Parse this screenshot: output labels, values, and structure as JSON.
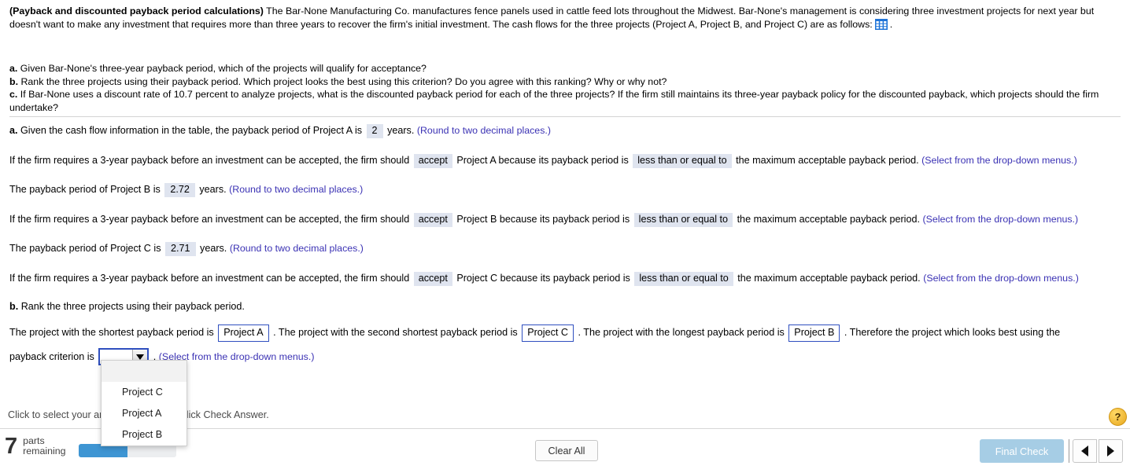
{
  "problem": {
    "title": "(Payback and discounted payback period calculations)",
    "body_1": "  The Bar-None Manufacturing Co. manufactures fence panels used in cattle feed lots throughout the Midwest.  Bar-None's management is considering three investment projects for next year but doesn't want to make any investment that requires more than three years to recover the firm's initial investment.  The cash flows for the three projects (Project A, Project B, and Project C) are as follows:",
    "table_icon": "table-icon",
    "body_2": ".",
    "items": [
      {
        "letter": "a.",
        "text": "Given Bar-None's three-year payback period, which of the projects will qualify for acceptance?"
      },
      {
        "letter": "b.",
        "text": "Rank the three projects using their payback period.  Which project looks the best using this criterion?  Do you agree with this ranking?  Why or why not?"
      },
      {
        "letter": "c.",
        "text": "If Bar-None uses a discount rate of 10.7 percent to analyze projects, what is the discounted payback period for each of the three projects?  If the firm still maintains its three-year payback policy for the discounted payback, which projects should the firm undertake?"
      }
    ]
  },
  "answers": {
    "a_label": "a.",
    "a_line_pre": "Given the cash flow information in the table, the payback period of Project A is",
    "a_value": "2",
    "a_line_post": "years.",
    "round_hint": "(Round to two decimal places.)",
    "accept_lines": [
      {
        "pre": "If the firm requires a 3-year payback before an investment can be accepted, the firm should",
        "accept": "accept",
        "mid": "Project A because its payback period is",
        "compare": "less than or equal to",
        "post": "the maximum acceptable payback period.",
        "hint": "(Select from the drop-down menus.)"
      },
      {
        "pre": "If the firm requires a 3-year payback before an investment can be accepted, the firm should",
        "accept": "accept",
        "mid": "Project B because its payback period is",
        "compare": "less than or equal to",
        "post": "the maximum acceptable payback period.",
        "hint": "(Select from the drop-down menus.)"
      },
      {
        "pre": "If the firm requires a 3-year payback before an investment can be accepted, the firm should",
        "accept": "accept",
        "mid": "Project C because its payback period is",
        "compare": "less than or equal to",
        "post": "the maximum acceptable payback period.",
        "hint": "(Select from the drop-down menus.)"
      }
    ],
    "b_payback_pre": "The payback period of Project B is",
    "b_payback_value": "2.72",
    "b_payback_post": "years.",
    "c_payback_pre": "The payback period of Project C is",
    "c_payback_value": "2.71",
    "c_payback_post": "years.",
    "b_label": "b.",
    "b_question": "Rank the three projects using their payback period.",
    "rank_pre": "The project with the shortest payback period is",
    "rank_shortest": "Project A",
    "rank_mid1": ".  The project with the second shortest payback period is",
    "rank_second": "Project C",
    "rank_mid2": ".  The project with the longest payback period is",
    "rank_longest": "Project B",
    "rank_post": ".  Therefore the project which looks best using the",
    "criterion_pre": "payback criterion is",
    "criterion_value": "",
    "criterion_post": ".",
    "criterion_hint": "(Select from the drop-down menus.)"
  },
  "dropdown": {
    "options": [
      "",
      "Project C",
      "Project A",
      "Project B"
    ],
    "arrow_icon": "chevron-down-icon"
  },
  "footer": {
    "instruction": "Click to select your answer(s) and then click Check Answer.",
    "help_icon": "?",
    "remaining_count": "7",
    "remaining_line1": "parts",
    "remaining_line2": "remaining",
    "progress_percent": 50,
    "clear_all": "Clear All",
    "final_check": "Final Check",
    "prev_icon": "left-arrow-icon",
    "next_icon": "right-arrow-icon"
  },
  "colors": {
    "chip_bg": "#dfe4ef",
    "hint_text": "#3b32b4",
    "select_border": "#2f4fbf",
    "progress_fill": "#3e95d3",
    "final_check_bg": "#a6cde5",
    "help_bg": "#e8a820"
  }
}
